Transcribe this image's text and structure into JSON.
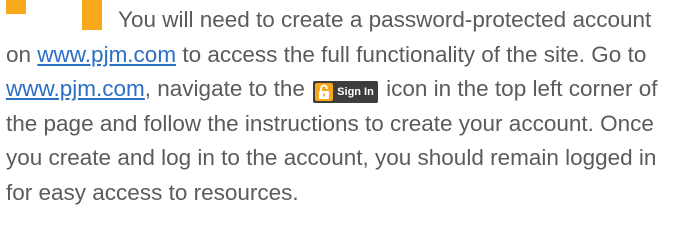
{
  "intro_text": "You will need to create a password-protected account on",
  "link_1": "www.pjm.com",
  "sentence_1_end": "to access the full functionality of the site. Go to",
  "link_2": "www.pjm.com",
  "sentence_2_start": ", navigate to the",
  "signin_button": {
    "label": "Sign In",
    "icon": "padlock-icon"
  },
  "sentence_2_end": "icon in the top left corner of the page and follow the instructions to create your account. Once you create and log in to the account, you should remain logged in for easy access to resources.",
  "colors": {
    "accent_orange": "#f7a81b",
    "text_gray": "#5b5b5b",
    "link_blue": "#2a6fc4",
    "button_dark": "#3d3d3d"
  }
}
